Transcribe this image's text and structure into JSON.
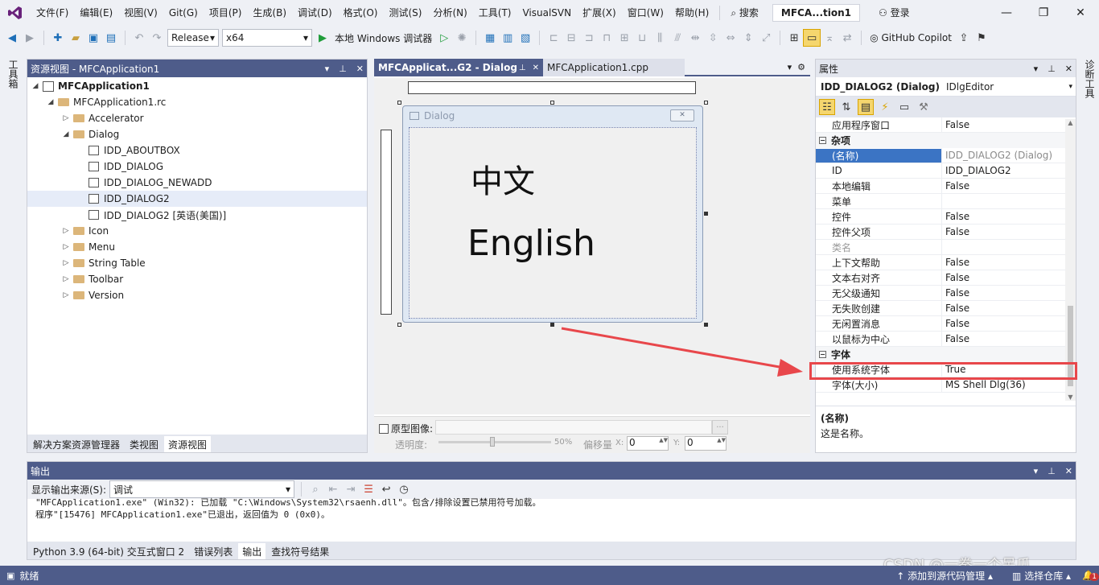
{
  "menubar": {
    "items": [
      "文件(F)",
      "编辑(E)",
      "视图(V)",
      "Git(G)",
      "项目(P)",
      "生成(B)",
      "调试(D)",
      "格式(O)",
      "测试(S)",
      "分析(N)",
      "工具(T)",
      "VisualSVN",
      "扩展(X)",
      "窗口(W)",
      "帮助(H)"
    ],
    "search": "搜索",
    "solution_name": "MFCA...tion1",
    "login": "登录"
  },
  "toolbar": {
    "config": "Release",
    "platform": "x64",
    "run_label": "本地 Windows 调试器",
    "copilot": "GitHub Copilot"
  },
  "left_strip": {
    "label": "工具箱"
  },
  "right_strip": {
    "label": "诊断工具"
  },
  "resource_view": {
    "title": "资源视图 - MFCApplication1",
    "tree": [
      {
        "label": "MFCApplication1",
        "level": 0,
        "type": "project",
        "expanded": true,
        "bold": true
      },
      {
        "label": "MFCApplication1.rc",
        "level": 1,
        "type": "folder",
        "expanded": true
      },
      {
        "label": "Accelerator",
        "level": 2,
        "type": "folder",
        "expanded": false
      },
      {
        "label": "Dialog",
        "level": 2,
        "type": "folder",
        "expanded": true
      },
      {
        "label": "IDD_ABOUTBOX",
        "level": 3,
        "type": "resource"
      },
      {
        "label": "IDD_DIALOG",
        "level": 3,
        "type": "resource"
      },
      {
        "label": "IDD_DIALOG_NEWADD",
        "level": 3,
        "type": "resource"
      },
      {
        "label": "IDD_DIALOG2",
        "level": 3,
        "type": "resource",
        "selected": true
      },
      {
        "label": "IDD_DIALOG2 [英语(美国)]",
        "level": 3,
        "type": "resource"
      },
      {
        "label": "Icon",
        "level": 2,
        "type": "folder",
        "expanded": false
      },
      {
        "label": "Menu",
        "level": 2,
        "type": "folder",
        "expanded": false
      },
      {
        "label": "String Table",
        "level": 2,
        "type": "folder",
        "expanded": false
      },
      {
        "label": "Toolbar",
        "level": 2,
        "type": "folder",
        "expanded": false
      },
      {
        "label": "Version",
        "level": 2,
        "type": "folder",
        "expanded": false
      }
    ],
    "bottom_tabs": [
      "解决方案资源管理器",
      "类视图",
      "资源视图"
    ]
  },
  "editor": {
    "tabs": [
      "MFCApplicat...G2 - Dialog",
      "MFCApplication1.cpp"
    ],
    "dialog_caption": "Dialog",
    "text_chinese": "中文",
    "text_english": "English",
    "prototype_label": "原型图像:",
    "opacity_label": "透明度:",
    "opacity_value": "50%",
    "offset_label": "偏移量",
    "x_label": "X:",
    "x_value": "0",
    "y_label": "Y:",
    "y_value": "0"
  },
  "properties": {
    "title": "属性",
    "object": "IDD_DIALOG2 (Dialog)",
    "editor": "IDlgEditor",
    "rows": [
      {
        "kind": "row",
        "key": "应用程序窗口",
        "value": "False"
      },
      {
        "kind": "cat",
        "key": "杂项"
      },
      {
        "kind": "row",
        "key": "(名称)",
        "value": "IDD_DIALOG2 (Dialog)",
        "selected": true
      },
      {
        "kind": "row",
        "key": "ID",
        "value": "IDD_DIALOG2"
      },
      {
        "kind": "row",
        "key": "本地编辑",
        "value": "False"
      },
      {
        "kind": "row",
        "key": "菜单",
        "value": ""
      },
      {
        "kind": "row",
        "key": "控件",
        "value": "False"
      },
      {
        "kind": "row",
        "key": "控件父项",
        "value": "False"
      },
      {
        "kind": "row",
        "key": "类名",
        "value": "",
        "disabled": true
      },
      {
        "kind": "row",
        "key": "上下文帮助",
        "value": "False"
      },
      {
        "kind": "row",
        "key": "文本右对齐",
        "value": "False"
      },
      {
        "kind": "row",
        "key": "无父级通知",
        "value": "False"
      },
      {
        "kind": "row",
        "key": "无失败创建",
        "value": "False"
      },
      {
        "kind": "row",
        "key": "无闲置消息",
        "value": "False"
      },
      {
        "kind": "row",
        "key": "以鼠标为中心",
        "value": "False"
      },
      {
        "kind": "cat",
        "key": "字体"
      },
      {
        "kind": "row",
        "key": "使用系统字体",
        "value": "True",
        "highlight": true
      },
      {
        "kind": "row",
        "key": "字体(大小)",
        "value": "MS Shell Dlg(36)"
      }
    ],
    "desc_title": "(名称)",
    "desc_text": "这是名称。"
  },
  "output": {
    "title": "输出",
    "source_label": "显示输出来源(S):",
    "source_value": "调试",
    "lines": [
      "\"MFCApplication1.exe\" (Win32): 已加载 \"C:\\Windows\\System32\\rsaenh.dll\"。包含/排除设置已禁用符号加载。",
      "程序\"[15476] MFCApplication1.exe\"已退出，返回值为 0 (0x0)。"
    ],
    "bottom_tabs": [
      "Python 3.9 (64-bit) 交互式窗口 2",
      "错误列表",
      "输出",
      "查找符号结果"
    ]
  },
  "statusbar": {
    "ready": "就绪",
    "add_source": "添加到源代码管理",
    "select_repo": "选择仓库",
    "watermark": "CSDN @一拳一个呆瓜",
    "badge": "1"
  },
  "colors": {
    "accent": "#4e5c8a",
    "highlight_box": "#e8474b",
    "arrow": "#e8474b"
  }
}
